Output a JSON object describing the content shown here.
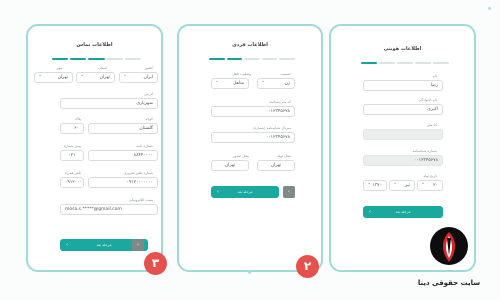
{
  "card3": {
    "title": "اطلاعات تماس",
    "labels": {
      "city": "شهر",
      "province": "استان",
      "country": "کشور",
      "address": "آدرس",
      "alley": "کوچه",
      "plaque": "پلاک",
      "landline": "شماره ثابت",
      "area_code": "پیش شماره",
      "mobile": "شماره تلفن ضروری",
      "mobile2": "تلفن همراه",
      "email": "پست الکترونیکی"
    },
    "values": {
      "city": "تهران",
      "province": "تهران",
      "country": "ایران",
      "address": "شهریاری",
      "alley": "گلستان",
      "plaque": "۶۰",
      "landline": "۸۸۴۴۰۰۰۰",
      "area_code": "۰۲۱",
      "mobile": "۰۹۱۲۰۰۰۰۰۰۰",
      "mobile2": "۰۹۱۲۰۰۰۰۰۰۰",
      "email": "mosa.s.*****@gmail.com"
    },
    "next_button": "مرحله بعد",
    "back_icon": "chevron-left-icon",
    "badge": "۳"
  },
  "card2": {
    "title": "اطلاعات فردی",
    "labels": {
      "gender": "جنسیت",
      "marital": "وضعیت تاهل",
      "national_id": "کد ملی/شناسه",
      "passport": "سریال شناسنامه (شماره)",
      "birthplace": "محل صدور",
      "birth_city": "محل تولد"
    },
    "values": {
      "gender": "زن",
      "marital": "متاهل",
      "national_id": "۰۰۱۲۳۴۵۶۷۸",
      "passport": "۰۰۱۲۳۴۵۶۷۸",
      "birthplace": "تهران",
      "birth_city": "تهران"
    },
    "next_button": "مرحله بعد",
    "back_icon": "chevron-left-icon",
    "badge": "۲"
  },
  "card1": {
    "title": "اطلاعات هویتی",
    "labels": {
      "first_name": "نام",
      "last_name": "نام خانوادگی",
      "national_code": "کد ملی",
      "id_number": "شماره شناسنامه",
      "birth_date": "تاریخ تولد"
    },
    "values": {
      "first_name": "رضا",
      "last_name": "اکبری",
      "national_code": "",
      "id_number": "۰۰۱۲۳۴۵۶۷۸",
      "birth_day": "۲۰",
      "birth_month": "تیر",
      "birth_year": "۱۳۷۰"
    },
    "next_button": "مرحله بعد"
  },
  "brand": {
    "name": "سایت حقوقی دینا",
    "logo_icon": "dina-logo-icon"
  },
  "colors": {
    "accent": "#1aa89f",
    "border": "#9fd9da",
    "badge": "#e5514c"
  }
}
